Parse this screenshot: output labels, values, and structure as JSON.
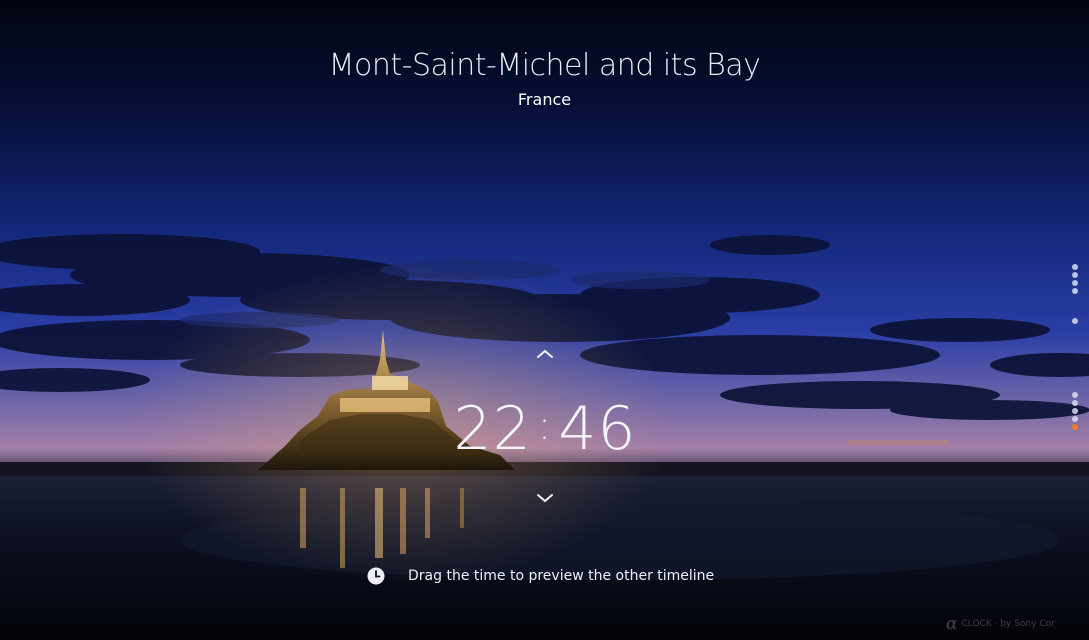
{
  "location": {
    "title": "Mont-Saint-Michel and its Bay",
    "country": "France"
  },
  "clock": {
    "hours": "22",
    "separator": ":",
    "minutes": "46"
  },
  "controls": {
    "up_icon": "chevron-up-icon",
    "down_icon": "chevron-down-icon"
  },
  "hint": {
    "icon": "clock-icon",
    "text": "Drag the time to preview the other timeline"
  },
  "timeline": {
    "dot_count": 10,
    "active_index": 9,
    "active_color": "#f07a2a"
  },
  "brand": {
    "mark": "α",
    "text": "CLOCK · by Sony Cor"
  },
  "colors": {
    "sky_top": "#03061a",
    "sky_mid": "#1a2f8a",
    "horizon": "#8a6da8",
    "text": "#ffffff"
  }
}
